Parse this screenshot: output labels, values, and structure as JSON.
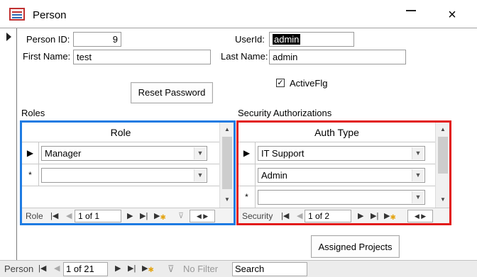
{
  "window": {
    "title": "Person",
    "close_icon": "×"
  },
  "form": {
    "person_id_label": "Person ID:",
    "person_id_value": "9",
    "first_name_label": "First Name:",
    "first_name_value": "test",
    "userid_label": "UserId:",
    "userid_value": "admin",
    "last_name_label": "Last Name:",
    "last_name_value": "admin",
    "activeflg_label": "ActiveFlg",
    "activeflg_checked": "✓",
    "reset_password_label": "Reset Password",
    "roles_label": "Roles",
    "security_label": "Security Authorizations",
    "assigned_projects_label": "Assigned Projects"
  },
  "roles": {
    "header": "Role",
    "rows": [
      {
        "marker": "▶",
        "value": "Manager"
      },
      {
        "marker": "*",
        "value": ""
      }
    ],
    "nav": {
      "label": "Role",
      "position": "1 of 1"
    }
  },
  "security": {
    "header": "Auth Type",
    "rows": [
      {
        "marker": "▶",
        "value": "IT Support"
      },
      {
        "marker": "",
        "value": "Admin"
      },
      {
        "marker": "*",
        "value": ""
      }
    ],
    "nav": {
      "label": "Security",
      "position": "1 of 2"
    }
  },
  "record_nav": {
    "label": "Person",
    "position": "1 of 21",
    "filter_label": "No Filter",
    "search_placeholder": "Search"
  },
  "colors": {
    "roles_border": "#1e7be2",
    "security_border": "#e21a1a"
  }
}
